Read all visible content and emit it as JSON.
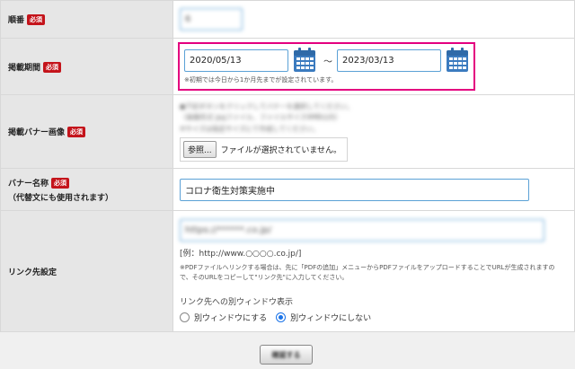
{
  "fields": {
    "order": {
      "label": "順番",
      "required": "必須",
      "value": "6"
    },
    "period": {
      "label": "掲載期間",
      "required": "必須",
      "start": "2020/05/13",
      "end": "2023/03/13",
      "separator": "～",
      "note": "※初期では今日から1か月先までが設定されています。"
    },
    "banner_image": {
      "label": "掲載バナー画像",
      "required": "必須",
      "instructions": [
        "●下記ボタンをクリックしてバナーを選択してください。",
        "（画像形式 jpgファイル、ファイルサイズ4MB以内）",
        "※サイズは指定サイズにて作成してください。"
      ],
      "browse_label": "参照...",
      "file_status": "ファイルが選択されていません。"
    },
    "banner_name": {
      "label": "バナー名称",
      "required": "必須",
      "sublabel": "（代替文にも使用されます）",
      "value": "コロナ衛生対策実施中"
    },
    "link": {
      "label": "リンク先設定",
      "value": "https://******.co.jp/",
      "example": "[例：http://www.○○○○.co.jp/]",
      "note": "※PDFファイルへリンクする場合は、先に「PDFの追加」メニューからPDFファイルをアップロードすることでURLが生成されますので、そのURLをコピーして\"リンク先\"に入力してください。",
      "window_label": "リンク先への別ウィンドウ表示",
      "option_new": "別ウィンドウにする",
      "option_same": "別ウィンドウにしない",
      "selected": "same"
    }
  },
  "actions": {
    "confirm_label": "確認する"
  },
  "colors": {
    "required_badge": "#c4141b",
    "highlight_border": "#e4007f",
    "input_border": "#5ba1d6",
    "calendar_icon": "#3b7bbf"
  },
  "icons": {
    "calendar": "calendar-icon"
  }
}
